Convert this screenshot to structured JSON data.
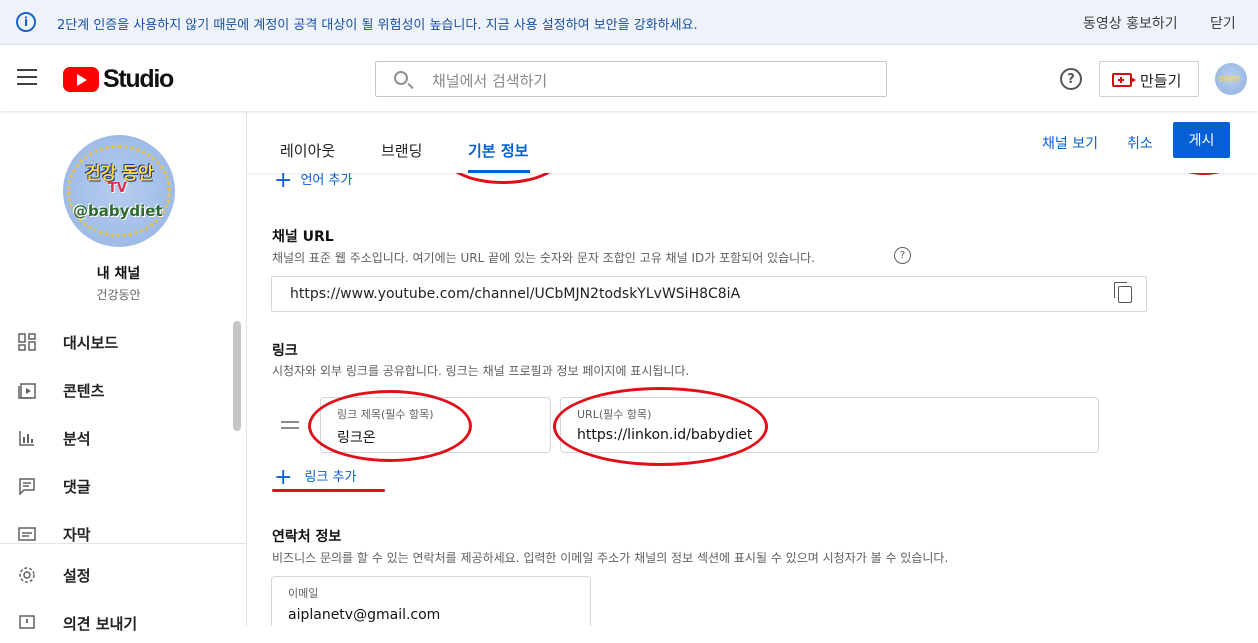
{
  "banner": {
    "message": "2단계 인증을 사용하지 않기 때문에 계정이 공격 대상이 될 위험성이 높습니다. 지금 사용 설정하여 보안을 강화하세요.",
    "promote": "동영상 홍보하기",
    "close": "닫기"
  },
  "header": {
    "logo_text": "Studio",
    "search_placeholder": "채널에서 검색하기",
    "help": "?",
    "create_label": "만들기"
  },
  "sidebar": {
    "avatar_text": [
      "건강 동안",
      "TV",
      "@babydiet"
    ],
    "channel_title": "내 채널",
    "channel_name": "건강동안",
    "items": [
      {
        "label": "대시보드",
        "icon": "dashboard-icon"
      },
      {
        "label": "콘텐츠",
        "icon": "content-icon"
      },
      {
        "label": "분석",
        "icon": "analytics-icon"
      },
      {
        "label": "댓글",
        "icon": "comments-icon"
      },
      {
        "label": "자막",
        "icon": "subtitles-icon"
      },
      {
        "label": "설정",
        "icon": "settings-icon"
      },
      {
        "label": "의견 보내기",
        "icon": "feedback-icon"
      }
    ]
  },
  "tabs": [
    {
      "label": "레이아웃"
    },
    {
      "label": "브랜딩"
    },
    {
      "label": "기본 정보"
    }
  ],
  "actions": {
    "view_channel": "채널 보기",
    "cancel": "취소",
    "publish": "게시"
  },
  "partial_add_language": "언어 추가",
  "channel_url": {
    "title": "채널 URL",
    "description": "채널의 표준 웹 주소입니다. 여기에는 URL 끝에 있는 숫자와 문자 조합인 고유 채널 ID가 포함되어 있습니다.",
    "value": "https://www.youtube.com/channel/UCbMJN2todskYLvWSiH8C8iA"
  },
  "links": {
    "title": "링크",
    "description": "시청자와 외부 링크를 공유합니다. 링크는 채널 프로필과 정보 페이지에 표시됩니다.",
    "title_label": "링크 제목(필수 항목)",
    "title_value": "링크온",
    "url_label": "URL(필수 항목)",
    "url_value": "https://linkon.id/babydiet",
    "add_label": "링크 추가"
  },
  "contact": {
    "title": "연락처 정보",
    "description": "비즈니스 문의를 할 수 있는 연락처를 제공하세요. 입력한 이메일 주소가 채널의 정보 섹션에 표시될 수 있으며 시청자가 볼 수 있습니다.",
    "email_label": "이메일",
    "email_value": "aiplanetv@gmail.com"
  },
  "colors": {
    "accent": "#065fd4",
    "annotation": "#e0101a",
    "brand": "#ff0000"
  }
}
